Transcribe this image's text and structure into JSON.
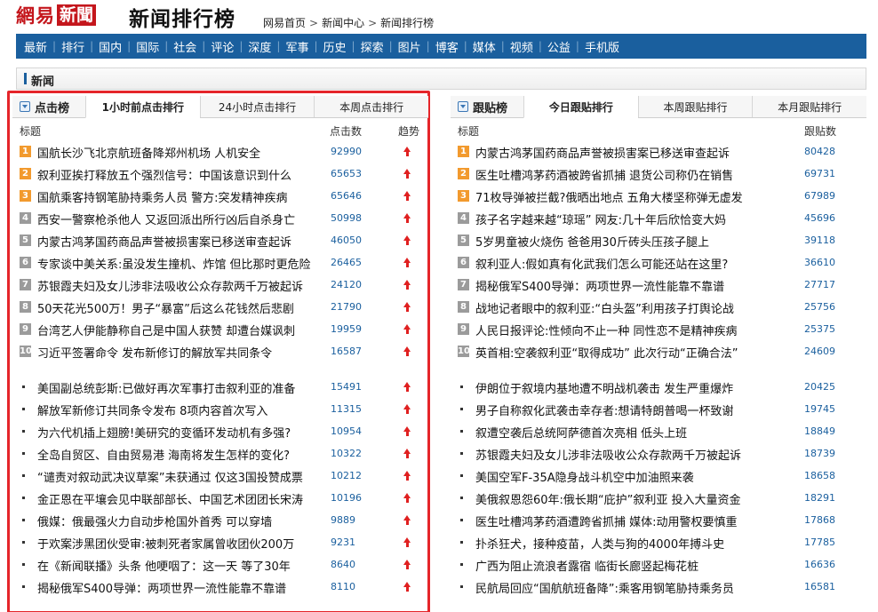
{
  "header": {
    "brand": "網易",
    "brand_news": "新聞",
    "page_title": "新闻排行榜",
    "breadcrumbs": [
      "网易首页",
      "新闻中心",
      "新闻排行榜"
    ],
    "breadcrumb_sep": ">"
  },
  "nav": [
    "最新",
    "排行",
    "国内",
    "国际",
    "社会",
    "评论",
    "深度",
    "军事",
    "历史",
    "探索",
    "图片",
    "博客",
    "媒体",
    "视频",
    "公益",
    "手机版"
  ],
  "section": {
    "label": "新闻"
  },
  "colors": {
    "accent": "#1a5f9e",
    "highlight_border": "#e5252a",
    "rank_hot": "#f29a2e",
    "rank_cold": "#9b9b9b",
    "trend_up": "#e02020"
  },
  "left": {
    "panel_title": "点击榜",
    "tabs": [
      "1小时前点击排行",
      "24小时点击排行",
      "本周点击排行"
    ],
    "active_tab": 0,
    "columns": [
      "标题",
      "点击数",
      "趋势"
    ],
    "ranked": [
      {
        "rank": "1",
        "title": "国航长沙飞北京航班备降郑州机场 人机安全",
        "count": "92990"
      },
      {
        "rank": "2",
        "title": "叙利亚挨打释放五个强烈信号：中国该意识到什么",
        "count": "65653"
      },
      {
        "rank": "3",
        "title": "国航乘客持钢笔胁持乘务人员 警方:突发精神疾病",
        "count": "65646"
      },
      {
        "rank": "4",
        "title": "西安一警察枪杀他人 又返回派出所行凶后自杀身亡",
        "count": "50998"
      },
      {
        "rank": "5",
        "title": "内蒙古鸿茅国药商品声誉被损害案已移送审查起诉",
        "count": "46050"
      },
      {
        "rank": "6",
        "title": "专家谈中美关系:虽没发生撞机、炸馆 但比那时更危险",
        "count": "26465"
      },
      {
        "rank": "7",
        "title": "苏银霞夫妇及女儿涉非法吸收公众存款两千万被起诉",
        "count": "24120"
      },
      {
        "rank": "8",
        "title": "50天花光500万！男子“暴富”后这么花钱然后悲剧",
        "count": "21790"
      },
      {
        "rank": "9",
        "title": "台湾艺人伊能静称自己是中国人获赞 却遭台媒讽刺",
        "count": "19959"
      },
      {
        "rank": "10",
        "title": "习近平签署命令 发布新修订的解放军共同条令",
        "count": "16587"
      }
    ],
    "more": [
      {
        "title": "美国副总统彭斯:已做好再次军事打击叙利亚的准备",
        "count": "15491"
      },
      {
        "title": "解放军新修订共同条令发布 8项内容首次写入",
        "count": "11315"
      },
      {
        "title": "为六代机插上翅膀!美研究的变循环发动机有多强?",
        "count": "10954"
      },
      {
        "title": "全岛自贸区、自由贸易港 海南将发生怎样的变化?",
        "count": "10322"
      },
      {
        "title": "“谴责对叙动武决议草案”未获通过 仅这3国投赞成票",
        "count": "10212"
      },
      {
        "title": "金正恩在平壤会见中联部部长、中国艺术团团长宋涛",
        "count": "10196"
      },
      {
        "title": "俄媒：俄最强火力自动步枪国外首秀 可以穿墙",
        "count": "9889"
      },
      {
        "title": "于欢案涉黑团伙受审:被刺死者家属曾收团伙200万",
        "count": "9231"
      },
      {
        "title": "在《新闻联播》头条 他哽咽了：这一天 等了30年",
        "count": "8640"
      },
      {
        "title": "揭秘俄军S400导弹：两项世界一流性能靠不靠谱",
        "count": "8110"
      }
    ]
  },
  "right": {
    "panel_title": "跟贴榜",
    "tabs": [
      "今日跟贴排行",
      "本周跟贴排行",
      "本月跟贴排行"
    ],
    "active_tab": 0,
    "columns": [
      "标题",
      "跟贴数"
    ],
    "ranked": [
      {
        "rank": "1",
        "title": "内蒙古鸿茅国药商品声誉被损害案已移送审查起诉",
        "count": "80428"
      },
      {
        "rank": "2",
        "title": "医生吐槽鸿茅药酒被跨省抓捕 退货公司称仍在销售",
        "count": "69731"
      },
      {
        "rank": "3",
        "title": "71枚导弹被拦截?俄晒出地点 五角大楼坚称弹无虚发",
        "count": "67989"
      },
      {
        "rank": "4",
        "title": "孩子名字越来越“琼瑶” 网友:几十年后欣恰变大妈",
        "count": "45696"
      },
      {
        "rank": "5",
        "title": "5岁男童被火烧伤 爸爸用30斤砖头压孩子腿上",
        "count": "39118"
      },
      {
        "rank": "6",
        "title": "叙利亚人:假如真有化武我们怎么可能还站在这里?",
        "count": "36610"
      },
      {
        "rank": "7",
        "title": "揭秘俄军S400导弹：两项世界一流性能靠不靠谱",
        "count": "27717"
      },
      {
        "rank": "8",
        "title": "战地记者眼中的叙利亚:“白头盔”利用孩子打舆论战",
        "count": "25756"
      },
      {
        "rank": "9",
        "title": "人民日报评论:性倾向不止一种 同性恋不是精神疾病",
        "count": "25375"
      },
      {
        "rank": "10",
        "title": "英首相:空袭叙利亚“取得成功” 此次行动“正确合法”",
        "count": "24609"
      }
    ],
    "more": [
      {
        "title": "伊朗位于叙境内基地遭不明战机袭击 发生严重爆炸",
        "count": "20425"
      },
      {
        "title": "男子自称叙化武袭击幸存者:想请特朗普喝一杯致谢",
        "count": "19745"
      },
      {
        "title": "叙遭空袭后总统阿萨德首次亮相 低头上班",
        "count": "18849"
      },
      {
        "title": "苏银霞夫妇及女儿涉非法吸收公众存款两千万被起诉",
        "count": "18739"
      },
      {
        "title": "美国空军F-35A隐身战斗机空中加油照来袭",
        "count": "18658"
      },
      {
        "title": "美俄叙恩怨60年:俄长期“庇护”叙利亚 投入大量资金",
        "count": "18291"
      },
      {
        "title": "医生吐槽鸿茅药酒遭跨省抓捕 媒体:动用警权要慎重",
        "count": "17868"
      },
      {
        "title": "扑杀狂犬，接种疫苗，人类与狗的4000年搏斗史",
        "count": "17785"
      },
      {
        "title": "广西为阻止流浪者露宿 临街长廊竖起梅花桩",
        "count": "16636"
      },
      {
        "title": "民航局回应“国航航班备降”:乘客用钢笔胁持乘务员",
        "count": "16581"
      }
    ]
  }
}
